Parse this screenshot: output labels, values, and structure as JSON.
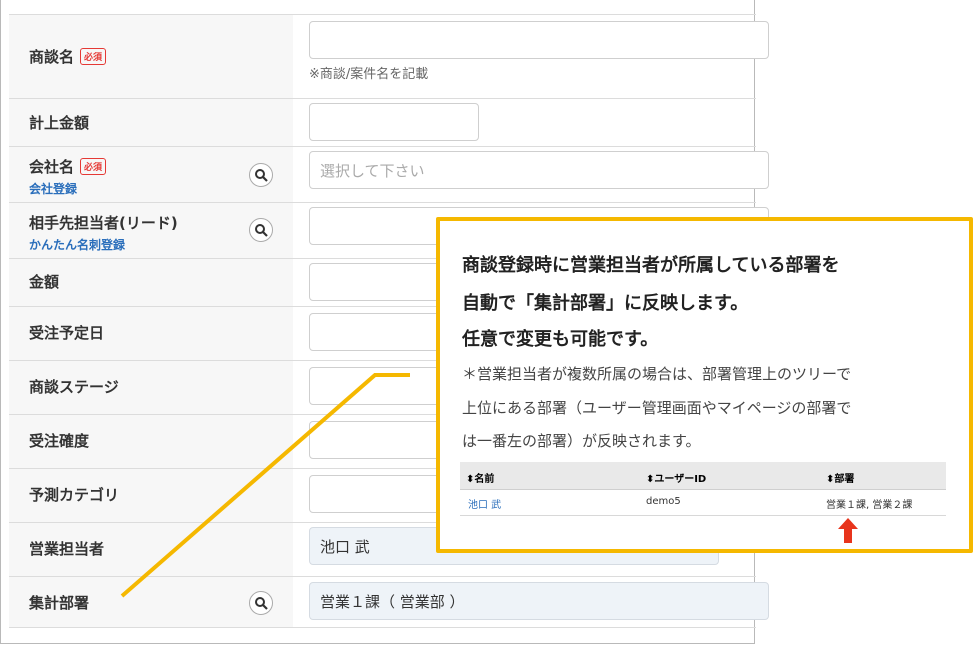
{
  "form": {
    "rows": [
      {
        "label": "商談名",
        "required": "必須",
        "hint": "※商談/案件名を記載",
        "value": ""
      },
      {
        "label": "計上金額",
        "value": ""
      },
      {
        "label": "会社名",
        "required": "必須",
        "link": "会社登録",
        "placeholder": "選択して下さい"
      },
      {
        "label": "相手先担当者(リード)",
        "link": "かんたん名刺登録",
        "value": ""
      },
      {
        "label": "金額",
        "value": ""
      },
      {
        "label": "受注予定日",
        "value": ""
      },
      {
        "label": "商談ステージ",
        "value": ""
      },
      {
        "label": "受注確度",
        "value": ""
      },
      {
        "label": "予測カテゴリ",
        "value": ""
      },
      {
        "label": "営業担当者",
        "value": "池口 武"
      },
      {
        "label": "集計部署",
        "value": "営業１課（ 営業部 ）"
      }
    ]
  },
  "callout": {
    "line1": "商談登録時に営業担当者が所属している部署を",
    "line2": "自動で「集計部署」に反映します。",
    "line3": "任意で変更も可能です。",
    "note1": "＊営業担当者が複数所属の場合は、部署管理上のツリーで",
    "note2": "上位にある部署（ユーザー管理画面やマイページの部署で",
    "note3": "は一番左の部署）が反映されます。",
    "table": {
      "headers": [
        "名前",
        "ユーザーID",
        "部署"
      ],
      "row": [
        "池口 武",
        "demo5",
        "営業１課, 営業２課"
      ]
    }
  },
  "colors": {
    "accent": "#f5b800",
    "link": "#2a6ebb",
    "required": "#e53935",
    "arrow": "#e8341c"
  }
}
